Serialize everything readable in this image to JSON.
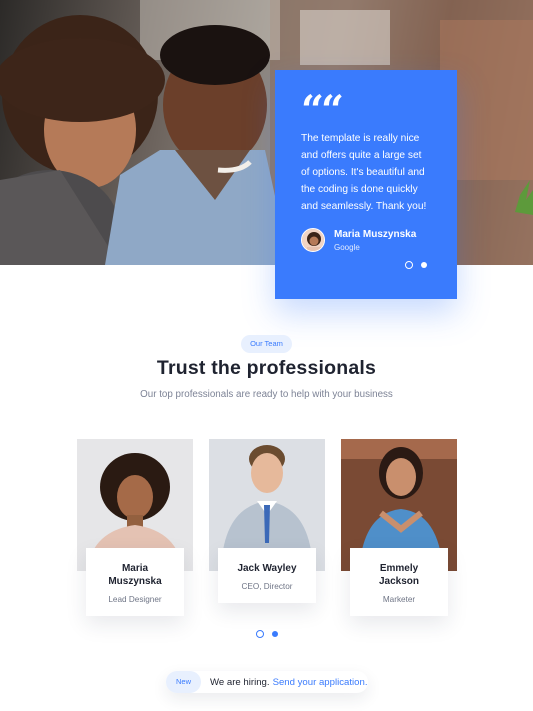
{
  "hero": {
    "image": "two-people-laughing-photo",
    "accent": "#3a7bfd"
  },
  "testimonial": {
    "quote_icon": "quote-icon",
    "quote_mark": "““",
    "text": "The template is really nice and offers quite a large set of options. It's beautiful and the coding is done quickly and seamlessly. Thank you!",
    "author_name": "Maria Muszynska",
    "author_company": "Google",
    "slides": 2,
    "active_slide": 1
  },
  "team": {
    "badge": "Our Team",
    "title": "Trust the professionals",
    "subtitle": "Our top professionals are ready to help with your business",
    "members": [
      {
        "name": "Maria Muszynska",
        "role": "Lead Designer"
      },
      {
        "name": "Jack Wayley",
        "role": "CEO, Director"
      },
      {
        "name": "Emmely Jackson",
        "role": "Marketer"
      }
    ],
    "slides": 2,
    "active_slide": 1
  },
  "hiring": {
    "badge": "New",
    "text": "We are hiring.",
    "link": "Send your application."
  },
  "colors": {
    "primary": "#3a7bfd",
    "badge_bg": "#e8f0fe",
    "text": "#1f2330",
    "muted": "#7d8396"
  }
}
